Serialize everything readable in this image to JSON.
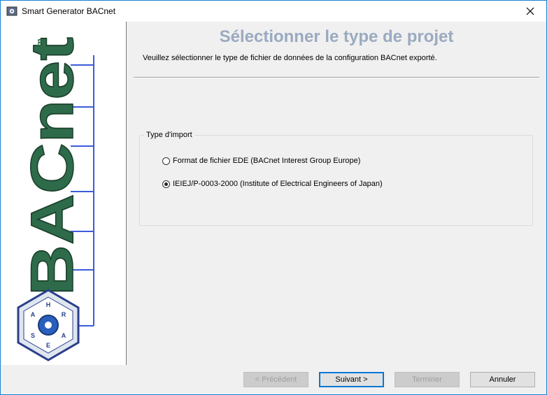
{
  "window": {
    "title": "Smart Generator BACnet",
    "close_glyph": "✕"
  },
  "sidebar": {
    "logo_text": "BACnet",
    "tm": "tm",
    "seal_letters": [
      "H",
      "R",
      "A",
      "E",
      "S",
      "A"
    ]
  },
  "header": {
    "title": "Sélectionner le type de projet",
    "subtitle": "Veuillez sélectionner le type de fichier de données de la configuration BACnet exporté."
  },
  "import_group": {
    "label": "Type d'import",
    "options": [
      {
        "label": "Format de fichier EDE (BACnet Interest Group Europe)",
        "selected": false
      },
      {
        "label": "IEIEJ/P-0003-2000 (Institute of Electrical Engineers of Japan)",
        "selected": true
      }
    ]
  },
  "footer": {
    "prev_label": "< Précédent",
    "next_label": "Suivant >",
    "finish_label": "Terminer",
    "cancel_label": "Annuler"
  },
  "colors": {
    "accent": "#1883d7",
    "header_title": "#9aaac0",
    "logo_green": "#2e6b4a",
    "logo_blue": "#3b5bdb"
  }
}
